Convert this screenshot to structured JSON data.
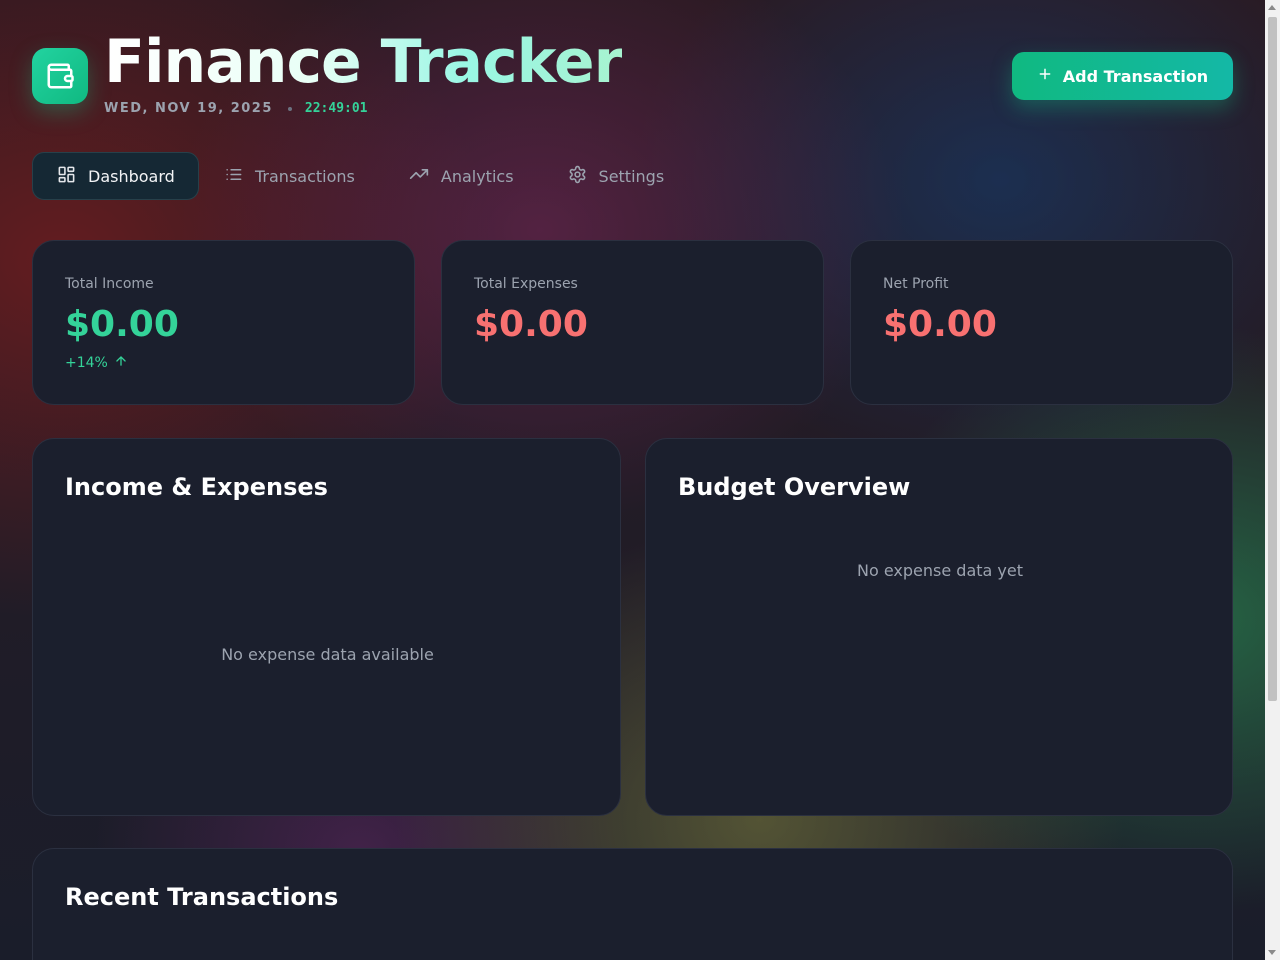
{
  "app": {
    "title": "Finance Tracker",
    "date": "WED, NOV 19, 2025",
    "time": "22:49:01",
    "add_button_label": "Add Transaction",
    "logo_icon": "wallet-icon"
  },
  "nav": {
    "tabs": [
      {
        "label": "Dashboard",
        "icon": "grid-icon",
        "active": true
      },
      {
        "label": "Transactions",
        "icon": "list-icon",
        "active": false
      },
      {
        "label": "Analytics",
        "icon": "trending-up-icon",
        "active": false
      },
      {
        "label": "Settings",
        "icon": "gear-icon",
        "active": false
      }
    ]
  },
  "stats": [
    {
      "label": "Total Income",
      "value": "$0.00",
      "change": "+14%",
      "color": "#34d399"
    },
    {
      "label": "Total Expenses",
      "value": "$0.00",
      "color": "#f87171"
    },
    {
      "label": "Net Profit",
      "value": "$0.00",
      "color": "#f87171"
    }
  ],
  "panels": {
    "income_expenses": {
      "title": "Income & Expenses",
      "empty_text": "No expense data available"
    },
    "budget": {
      "title": "Budget Overview",
      "empty_text": "No expense data yet"
    },
    "recent": {
      "title": "Recent Transactions"
    }
  },
  "colors": {
    "accent": "#10b981",
    "income": "#34d399",
    "expense": "#f87171",
    "card_bg": "#1b1f2d"
  }
}
